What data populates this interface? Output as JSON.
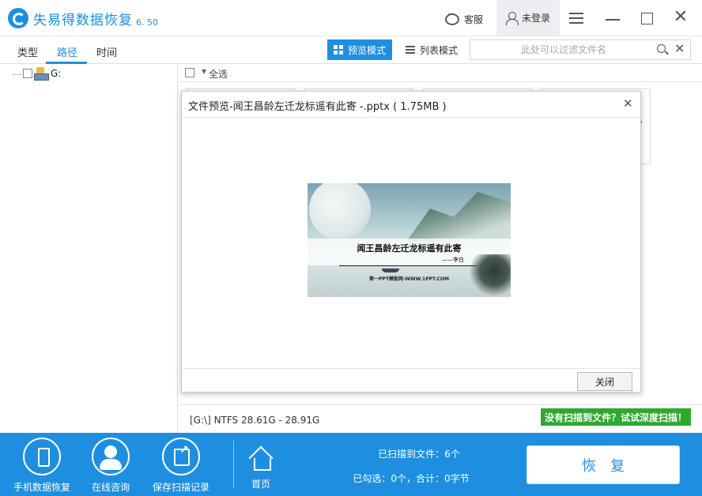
{
  "app": {
    "title": "失易得数据恢复",
    "version": "6. 50",
    "brand_color": "#1e8fe0"
  },
  "titlebar": {
    "service_label": "客服",
    "login_label": "未登录",
    "icons": [
      "chat-icon",
      "user-icon",
      "menu-icon",
      "minimize-icon",
      "maximize-icon",
      "close-icon"
    ]
  },
  "tabs": [
    {
      "label": "类型",
      "active": false
    },
    {
      "label": "路径",
      "active": true
    },
    {
      "label": "时间",
      "active": false
    }
  ],
  "view_modes": {
    "preview_label": "预览模式",
    "list_label": "列表模式",
    "active": "preview"
  },
  "filter": {
    "placeholder": "此处可以过滤文件名",
    "value": ""
  },
  "tree": {
    "root_label": "G:"
  },
  "content": {
    "select_all_label": "全选",
    "partial_text": "/"
  },
  "dialog": {
    "title": "文件预览-闻王昌龄左迁龙标遥有此寄 -.pptx ( 1.75MB )",
    "close_label": "关闭",
    "slide": {
      "title": "闻王昌龄左迁龙标遥有此寄",
      "author": "——李白",
      "site": "第一PPT模板网-WWW.1PPT.COM"
    }
  },
  "status": {
    "drive_info": "[G:\\] NTFS 28.61G - 28.91G",
    "deep_scan_label": "没有扫描到文件？试试深度扫描！",
    "deep_scan_color": "#2fa82f"
  },
  "bottom": {
    "phone_recovery_label": "手机数据恢复",
    "online_consult_label": "在线咨询",
    "save_record_label": "保存扫描记录",
    "home_label": "首页",
    "scanned_text": "已扫描到文件：6个",
    "selected_text": "已勾选：0个，合计：0字节",
    "recover_label": "恢复"
  }
}
